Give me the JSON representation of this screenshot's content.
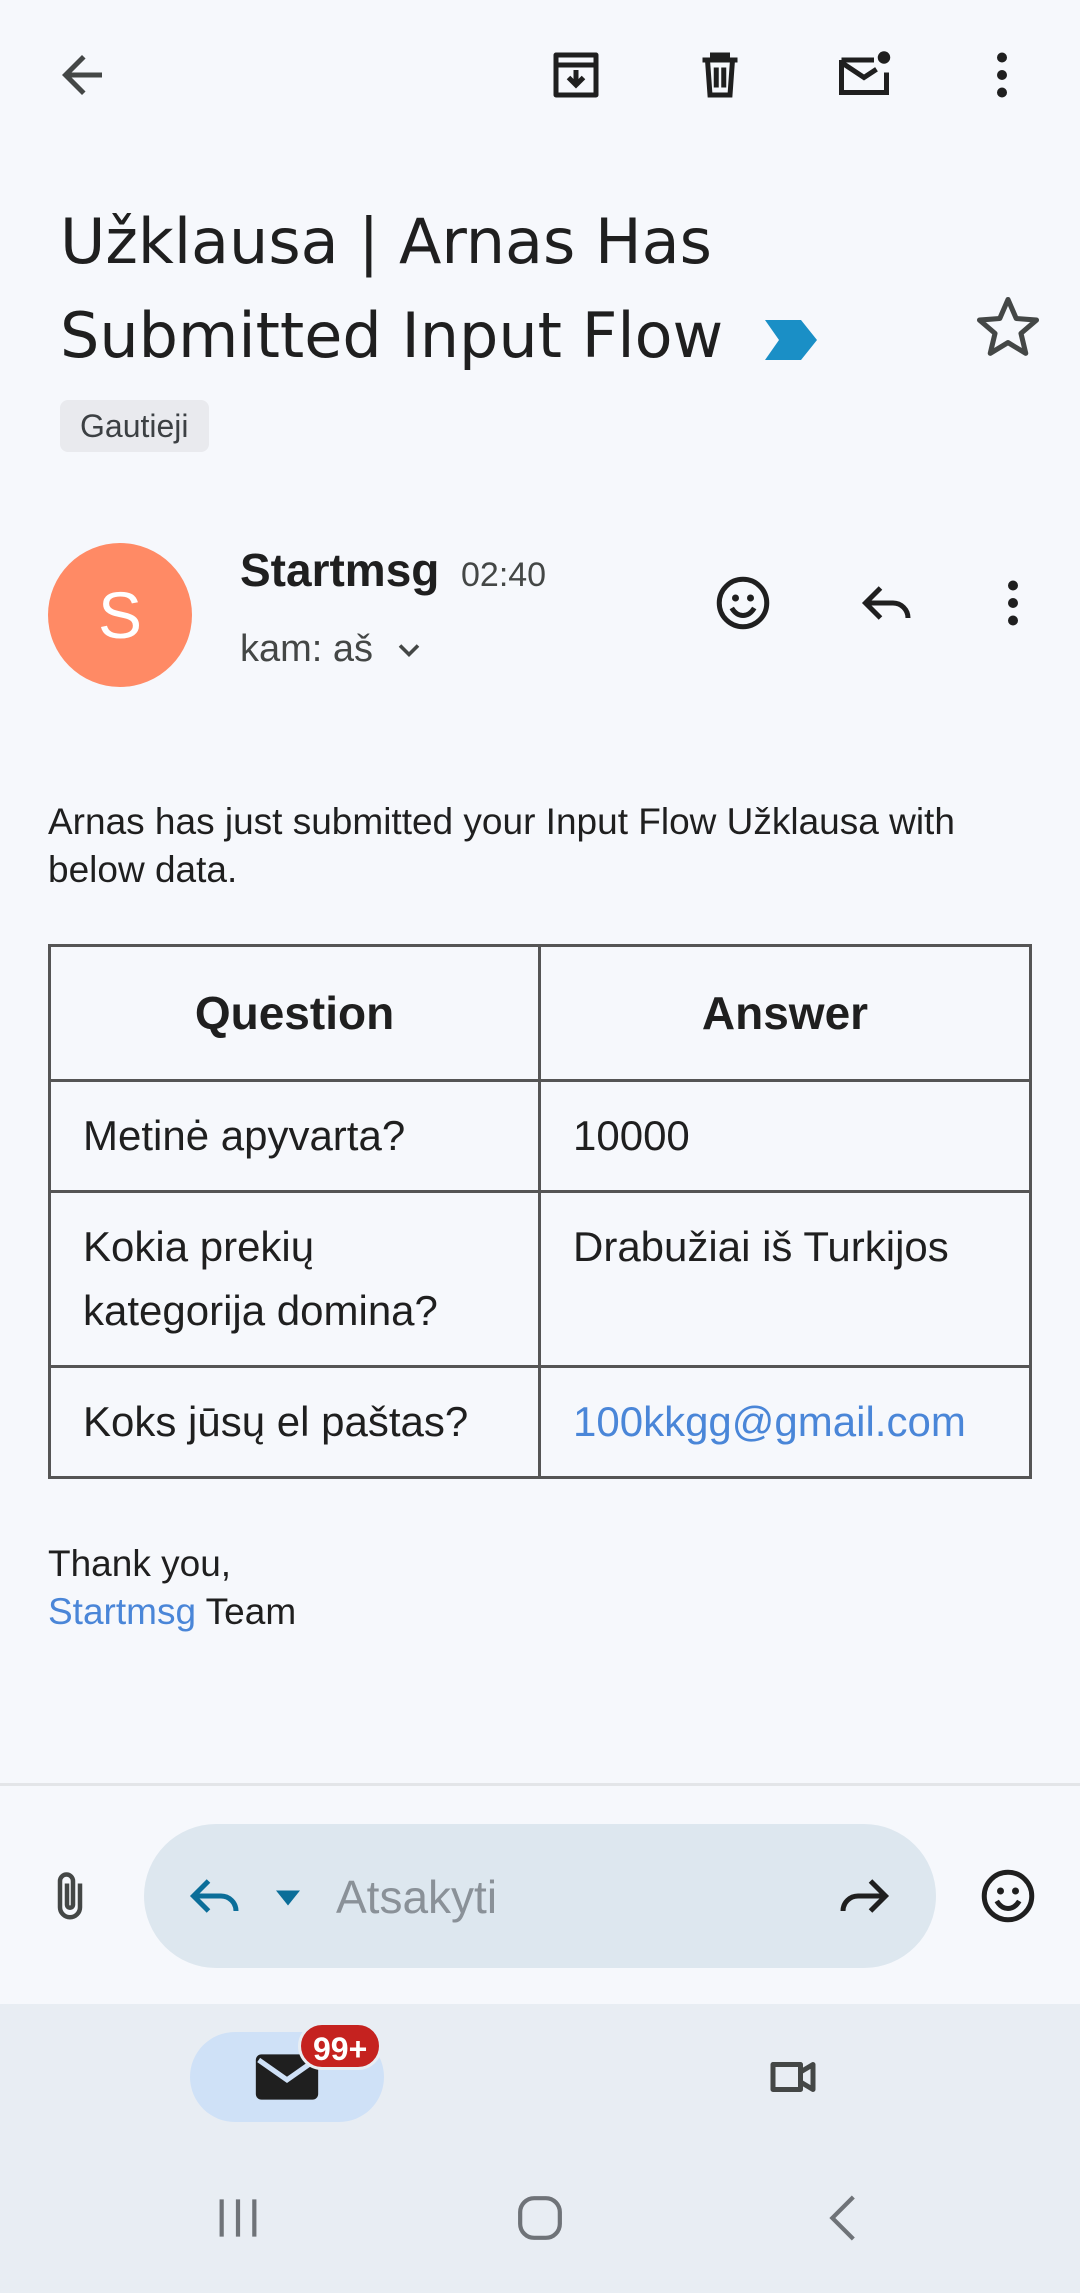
{
  "subject": {
    "title": "Užklausa | Arnas Has Submitted Input Flow",
    "label": "Gautieji"
  },
  "sender": {
    "avatar_letter": "S",
    "name": "Startmsg",
    "time": "02:40",
    "recipient": "kam: aš"
  },
  "body": {
    "intro": "Arnas has just submitted your Input Flow Užklausa with below data.",
    "table": {
      "headers": [
        "Question",
        "Answer"
      ],
      "rows": [
        {
          "question": "Metinė apyvarta?",
          "answer": "10000"
        },
        {
          "question": "Kokia prekių kategorija domina?",
          "answer": "Drabužiai iš Turkijos"
        },
        {
          "question": "Koks jūsų el paštas?",
          "answer": "100kkgg@gmail.com"
        }
      ]
    },
    "signoff_line1": "Thank you,",
    "signoff_brand": "Startmsg",
    "signoff_team": " Team"
  },
  "reply_bar": {
    "placeholder": "Atsakyti"
  },
  "bottom_nav": {
    "mail_badge": "99+"
  },
  "colors": {
    "accent": "#4a86d8",
    "avatar": "#ff8a65",
    "badge": "#c5221f",
    "importance": "#1a8fc6"
  },
  "icons": [
    "back-arrow-icon",
    "archive-icon",
    "trash-icon",
    "mark-unread-icon",
    "more-vert-icon",
    "importance-marker-icon",
    "star-icon",
    "emoji-icon",
    "reply-icon",
    "chevron-down-icon",
    "attachment-icon",
    "forward-icon",
    "mail-icon",
    "video-icon",
    "recents-icon",
    "home-icon",
    "back-nav-icon"
  ]
}
